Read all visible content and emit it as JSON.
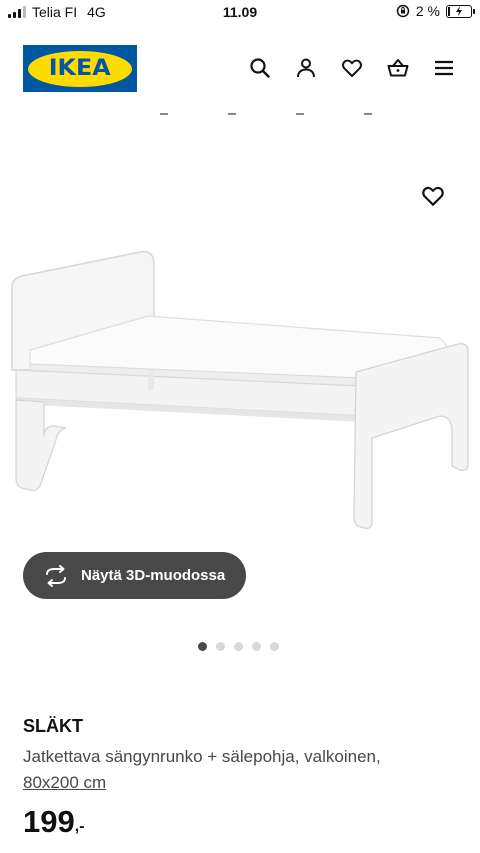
{
  "status_bar": {
    "carrier": "Telia FI",
    "network": "4G",
    "time": "11.09",
    "battery": "2 %"
  },
  "header": {
    "logo_text": "IKEA",
    "icons": [
      "search-icon",
      "user-icon",
      "heart-icon",
      "basket-icon",
      "menu-icon"
    ]
  },
  "gallery": {
    "view_3d_label": "Näytä 3D-muodossa",
    "slide_count": 5,
    "active_slide": 1
  },
  "product": {
    "name": "SLÄKT",
    "description": "Jatkettava sängynrunko + sälepohja, valkoinen,",
    "size": "80x200 cm",
    "price": "199",
    "price_suffix": ",-"
  },
  "colors": {
    "ikea_blue": "#0058a3",
    "ikea_yellow": "#ffdb00",
    "button_dark": "#484848"
  }
}
